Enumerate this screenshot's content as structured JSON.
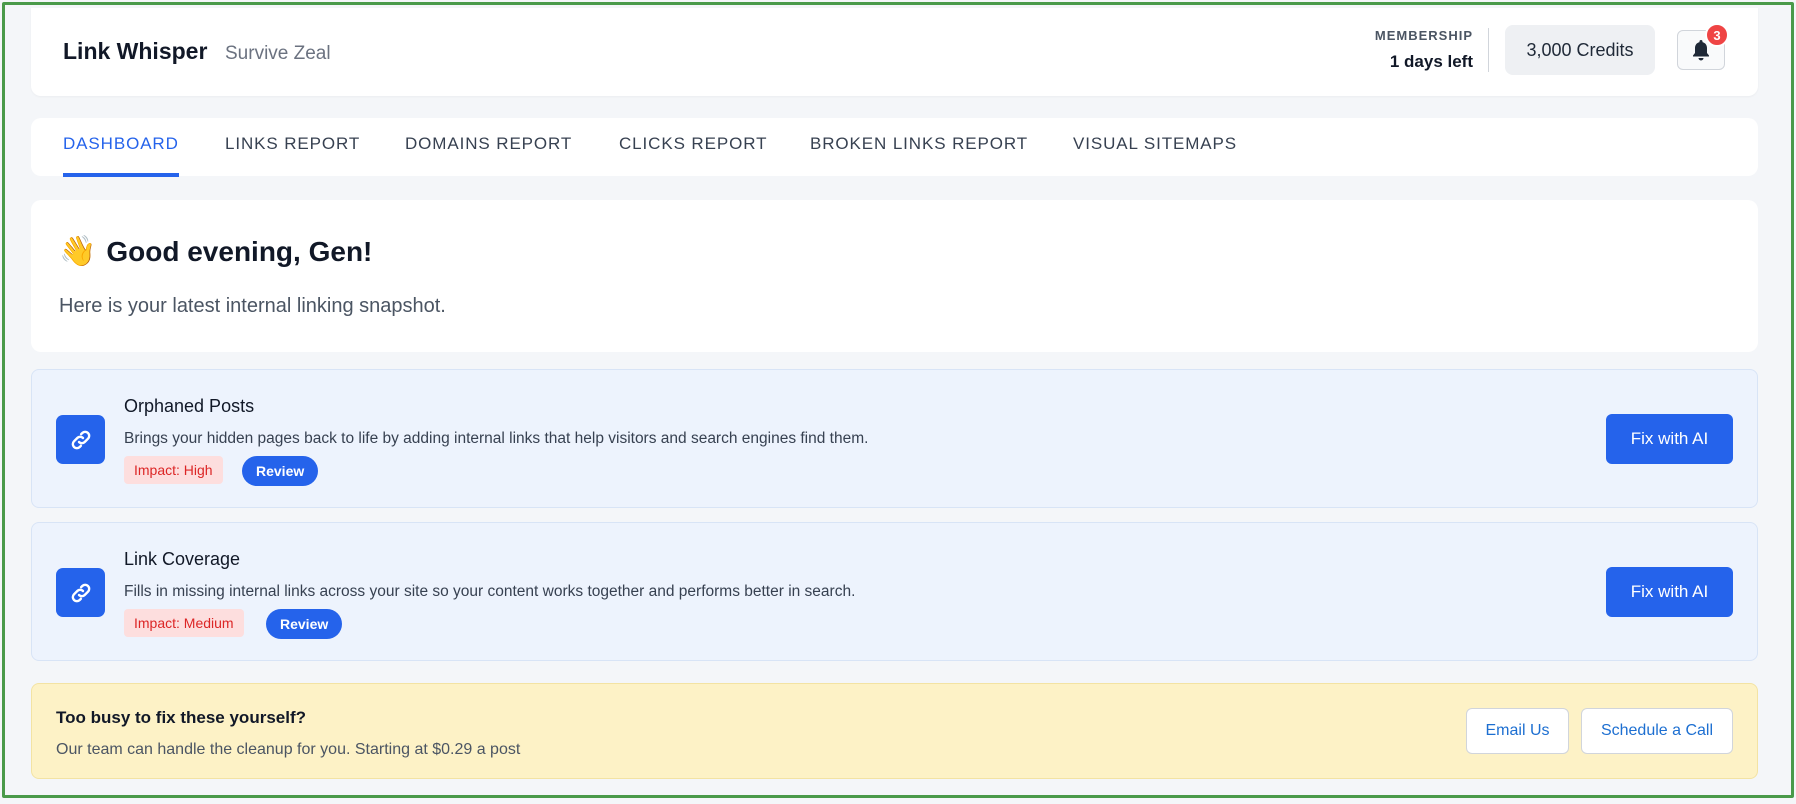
{
  "header": {
    "brand": "Link Whisper",
    "site": "Survive Zeal",
    "membership_label": "MEMBERSHIP",
    "membership_value": "1 days left",
    "credits": "3,000 Credits",
    "notification_count": "3"
  },
  "tabs": [
    {
      "label": "DASHBOARD",
      "active": true
    },
    {
      "label": "LINKS REPORT",
      "active": false
    },
    {
      "label": "DOMAINS REPORT",
      "active": false
    },
    {
      "label": "CLICKS REPORT",
      "active": false
    },
    {
      "label": "BROKEN LINKS REPORT",
      "active": false
    },
    {
      "label": "VISUAL SITEMAPS",
      "active": false
    }
  ],
  "welcome": {
    "emoji": "👋",
    "greeting": "Good evening, Gen!",
    "subtitle": "Here is your latest internal linking snapshot."
  },
  "tasks": [
    {
      "icon": "link-icon",
      "title": "Orphaned Posts",
      "description": "Brings your hidden pages back to life by adding internal links that help visitors and search engines find them.",
      "impact": "Impact: High",
      "review_label": "Review",
      "action_label": "Fix with AI"
    },
    {
      "icon": "link-icon",
      "title": "Link Coverage",
      "description": "Fills in missing internal links across your site so your content works together and performs better in search.",
      "impact": "Impact: Medium",
      "review_label": "Review",
      "action_label": "Fix with AI"
    }
  ],
  "help": {
    "title": "Too busy to fix these yourself?",
    "subtitle": "Our team can handle the cleanup for you. Starting at $0.29 a post",
    "email_label": "Email Us",
    "call_label": "Schedule a Call"
  },
  "colors": {
    "accent": "#2563eb",
    "impact_text": "#dc2626",
    "impact_bg": "#fddede",
    "task_bg": "#edf3fd",
    "help_bg": "#fdf2c6"
  }
}
